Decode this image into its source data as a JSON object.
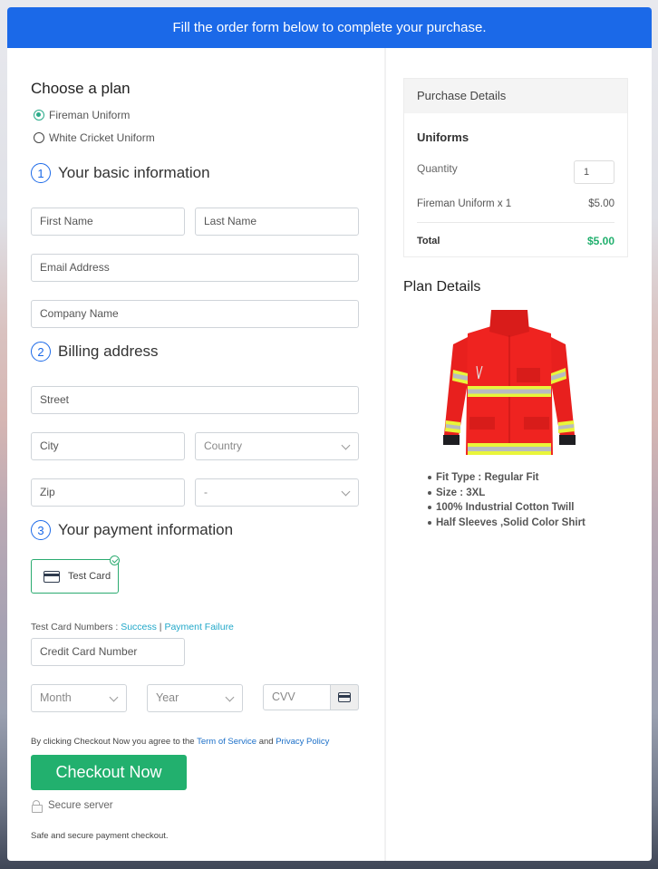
{
  "banner": {
    "text": "Fill the order form below to complete your purchase."
  },
  "plan": {
    "title": "Choose a plan",
    "options": [
      {
        "label": "Fireman Uniform",
        "selected": true
      },
      {
        "label": "White Cricket Uniform",
        "selected": false
      }
    ]
  },
  "basic_info": {
    "number": "1",
    "title": "Your basic information",
    "first_name_placeholder": "First Name",
    "last_name_placeholder": "Last Name",
    "email_placeholder": "Email Address",
    "company_placeholder": "Company Name"
  },
  "billing": {
    "number": "2",
    "title": "Billing address",
    "street_placeholder": "Street",
    "city_placeholder": "City",
    "country_selected": "Country",
    "zip_placeholder": "Zip",
    "state_selected": "-"
  },
  "payment": {
    "number": "3",
    "title": "Your payment information",
    "card_option_label": "Test Card",
    "test_numbers_label": "Test Card Numbers : ",
    "success_link": "Success",
    "separator": " | ",
    "failure_link": "Payment Failure",
    "card_number_placeholder": "Credit Card Number",
    "month_selected": "Month",
    "year_selected": "Year",
    "cvv_placeholder": "CVV"
  },
  "agreement": {
    "prefix": "By clicking Checkout Now you agree to the ",
    "terms_link": "Term of Service",
    "and": " and ",
    "privacy_link": "Privacy Policy"
  },
  "checkout_button": "Checkout Now",
  "secure_label": "Secure server",
  "safe_label": "Safe and secure payment checkout.",
  "purchase_details": {
    "title": "Purchase Details",
    "section": "Uniforms",
    "quantity_label": "Quantity",
    "quantity_value": "1",
    "item_label": "Fireman Uniform x 1",
    "item_price": "$5.00",
    "total_label": "Total",
    "total_value": "$5.00"
  },
  "plan_details": {
    "title": "Plan Details",
    "image_alt": "Red fireman jacket with reflective stripes",
    "features": [
      "Fit Type : Regular Fit",
      "Size : 3XL",
      "100% Industrial Cotton Twill",
      "Half Sleeves ,Solid Color Shirt"
    ]
  },
  "colors": {
    "brand_blue": "#1b69e8",
    "success_green": "#22b06e",
    "link_teal": "#22a8c9"
  }
}
